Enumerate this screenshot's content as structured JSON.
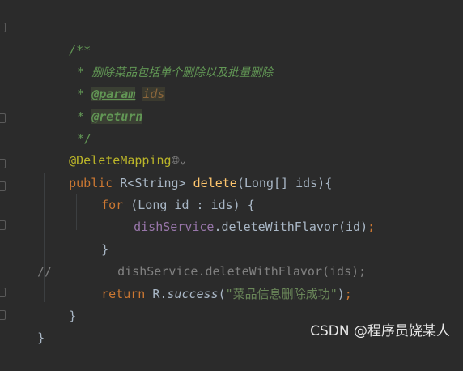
{
  "code": {
    "l1": "/**",
    "l2_star": "* ",
    "l2_text": "删除菜品包括单个删除以及批量删除",
    "l3_star": "* ",
    "l3_tag": "@param",
    "l3_space": " ",
    "l3_param": "ids",
    "l4_star": "* ",
    "l4_tag": "@return",
    "l5": "*/",
    "l6_ann": "@DeleteMapping",
    "l6_hint": "🌐︎⌄",
    "l7_kw": "public",
    "l7_type": " R<String> ",
    "l7_fn": "delete",
    "l7_rest": "(Long[] ids){",
    "l8_kw": "for",
    "l8_rest": " (Long id : ids) {",
    "l9_field": "dishService",
    "l9_rest": ".deleteWithFlavor(id)",
    "l9_semi": ";",
    "l10": "}",
    "l11_comment_prefix": "//",
    "l11_comment": "dishService.deleteWithFlavor(ids);",
    "l12_kw": "return",
    "l12_mid": " R.",
    "l12_static": "success",
    "l12_paren": "(",
    "l12_str": "\"菜品信息删除成功\"",
    "l12_end": ")",
    "l12_semi": ";",
    "l13": "}",
    "l14": "}"
  },
  "watermark": "CSDN @程序员饶某人"
}
